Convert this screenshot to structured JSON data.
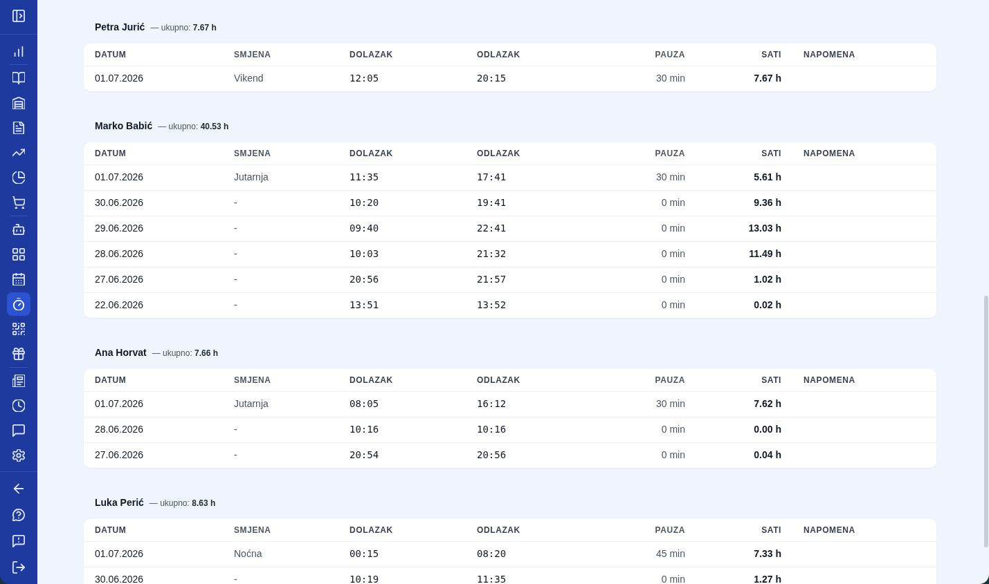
{
  "sidebar": {
    "items": [
      {
        "selected": false
      },
      {
        "selected": false
      },
      {
        "selected": false
      },
      {
        "selected": false
      },
      {
        "selected": false
      },
      {
        "selected": false
      },
      {
        "selected": false
      },
      {
        "selected": false
      },
      {
        "selected": false
      },
      {
        "selected": false
      },
      {
        "selected": true
      },
      {
        "selected": false
      },
      {
        "selected": false
      },
      {
        "selected": false
      },
      {
        "selected": false
      },
      {
        "selected": false
      },
      {
        "selected": false
      }
    ]
  },
  "employees": [
    {
      "name": "Petra Jurić",
      "total": "— ukupno: **7.67 h**",
      "columns": [
        {
          "label": "DATUM",
          "kind": "date"
        },
        {
          "label": "SMJENA",
          "kind": "shift"
        },
        {
          "label": "DOLAZAK",
          "kind": "time"
        },
        {
          "label": "ODLAZAK",
          "kind": "time"
        },
        {
          "label": "PAUZA",
          "kind": "duration"
        },
        {
          "label": "SATI",
          "kind": "hours"
        },
        {
          "label": "NAPOMENA",
          "kind": "note"
        }
      ],
      "rows": [
        [
          "01.07.2026",
          "Vikend",
          "12:05",
          "20:15",
          "30 min",
          "7.67 h"
        ]
      ]
    },
    {
      "name": "Marko Babić",
      "total": "— ukupno: **40.53 h**",
      "columns": [
        {
          "label": "DATUM",
          "kind": "date"
        },
        {
          "label": "SMJENA",
          "kind": "shift"
        },
        {
          "label": "DOLAZAK",
          "kind": "time"
        },
        {
          "label": "ODLAZAK",
          "kind": "time"
        },
        {
          "label": "PAUZA",
          "kind": "duration"
        },
        {
          "label": "SATI",
          "kind": "hours"
        },
        {
          "label": "NAPOMENA",
          "kind": "note"
        }
      ],
      "rows": [
        [
          "01.07.2026",
          "Jutarnja",
          "11:35",
          "17:41",
          "30 min",
          "5.61 h"
        ],
        [
          "30.06.2026",
          "-",
          "10:20",
          "19:41",
          "0 min",
          "9.36 h"
        ],
        [
          "29.06.2026",
          "-",
          "09:40",
          "22:41",
          "0 min",
          "13.03 h"
        ],
        [
          "28.06.2026",
          "-",
          "10:03",
          "21:32",
          "0 min",
          "11.49 h"
        ],
        [
          "27.06.2026",
          "-",
          "20:56",
          "21:57",
          "0 min",
          "1.02 h"
        ],
        [
          "22.06.2026",
          "-",
          "13:51",
          "13:52",
          "0 min",
          "0.02 h"
        ]
      ]
    },
    {
      "name": "Ana Horvat",
      "total": "— ukupno: **7.66 h**",
      "columns": [
        {
          "label": "DATUM",
          "kind": "date"
        },
        {
          "label": "SMJENA",
          "kind": "shift"
        },
        {
          "label": "DOLAZAK",
          "kind": "time"
        },
        {
          "label": "ODLAZAK",
          "kind": "time"
        },
        {
          "label": "PAUZA",
          "kind": "duration"
        },
        {
          "label": "SATI",
          "kind": "hours"
        },
        {
          "label": "NAPOMENA",
          "kind": "note"
        }
      ],
      "rows": [
        [
          "01.07.2026",
          "Jutarnja",
          "08:05",
          "16:12",
          "30 min",
          "7.62 h"
        ],
        [
          "28.06.2026",
          "-",
          "10:16",
          "10:16",
          "0 min",
          "0.00 h"
        ],
        [
          "27.06.2026",
          "-",
          "20:54",
          "20:56",
          "0 min",
          "0.04 h"
        ]
      ]
    },
    {
      "name": "Luka Perić",
      "total": "— ukupno: **8.63 h**",
      "columns": [
        {
          "label": "DATUM",
          "kind": "date"
        },
        {
          "label": "SMJENA",
          "kind": "shift"
        },
        {
          "label": "DOLAZAK",
          "kind": "time"
        },
        {
          "label": "ODLAZAK",
          "kind": "time"
        },
        {
          "label": "PAUZA",
          "kind": "duration"
        },
        {
          "label": "SATI",
          "kind": "hours"
        },
        {
          "label": "NAPOMENA",
          "kind": "note"
        }
      ],
      "rows": [
        [
          "01.07.2026",
          "Noćna",
          "00:15",
          "08:20",
          "45 min",
          "7.33 h"
        ],
        [
          "30.06.2026",
          "-",
          "10:19",
          "11:35",
          "0 min",
          "1.27 h"
        ]
      ]
    }
  ]
}
